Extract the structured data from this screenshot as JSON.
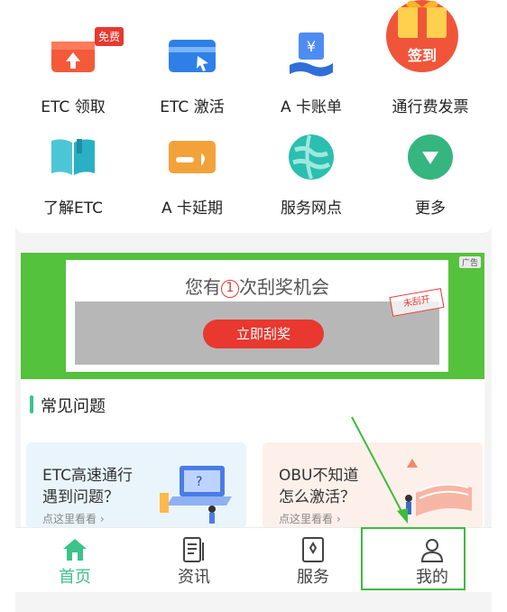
{
  "grid": [
    {
      "label": "ETC 领取",
      "icon": "etc-receive-icon"
    },
    {
      "label": "ETC 激活",
      "icon": "card-activate-icon"
    },
    {
      "label": "A 卡账单",
      "icon": "bill-icon"
    },
    {
      "label": "通行费发票",
      "icon": "gift-icon"
    },
    {
      "label": "了解ETC",
      "icon": "book-icon"
    },
    {
      "label": "A 卡延期",
      "icon": "card-extend-icon"
    },
    {
      "label": "服务网点",
      "icon": "globe-icon"
    },
    {
      "label": "更多",
      "icon": "chevron-down-icon"
    }
  ],
  "badge_free": "免费",
  "signin_label": "签到",
  "banner": {
    "ad_tag": "广告",
    "title_pre": "您有",
    "title_num": "1",
    "title_post": "次刮奖机会",
    "button": "立即刮奖",
    "stamp": "未刮开"
  },
  "faq": {
    "title": "常见问题",
    "cards": [
      {
        "line1": "ETC高速通行",
        "line2": "遇到问题？",
        "link": "点这里看看 ›"
      },
      {
        "line1": "OBU不知道",
        "line2": "怎么激活？",
        "link": "点这里看看 ›"
      }
    ]
  },
  "tabs": [
    {
      "label": "首页",
      "icon": "home-icon",
      "active": true
    },
    {
      "label": "资讯",
      "icon": "news-icon",
      "active": false
    },
    {
      "label": "服务",
      "icon": "service-icon",
      "active": false
    },
    {
      "label": "我的",
      "icon": "profile-icon",
      "active": false
    }
  ],
  "colors": {
    "accent": "#3cc38a",
    "red": "#e8382f",
    "banner_green": "#54c23c",
    "highlight": "#3dbb3d"
  }
}
